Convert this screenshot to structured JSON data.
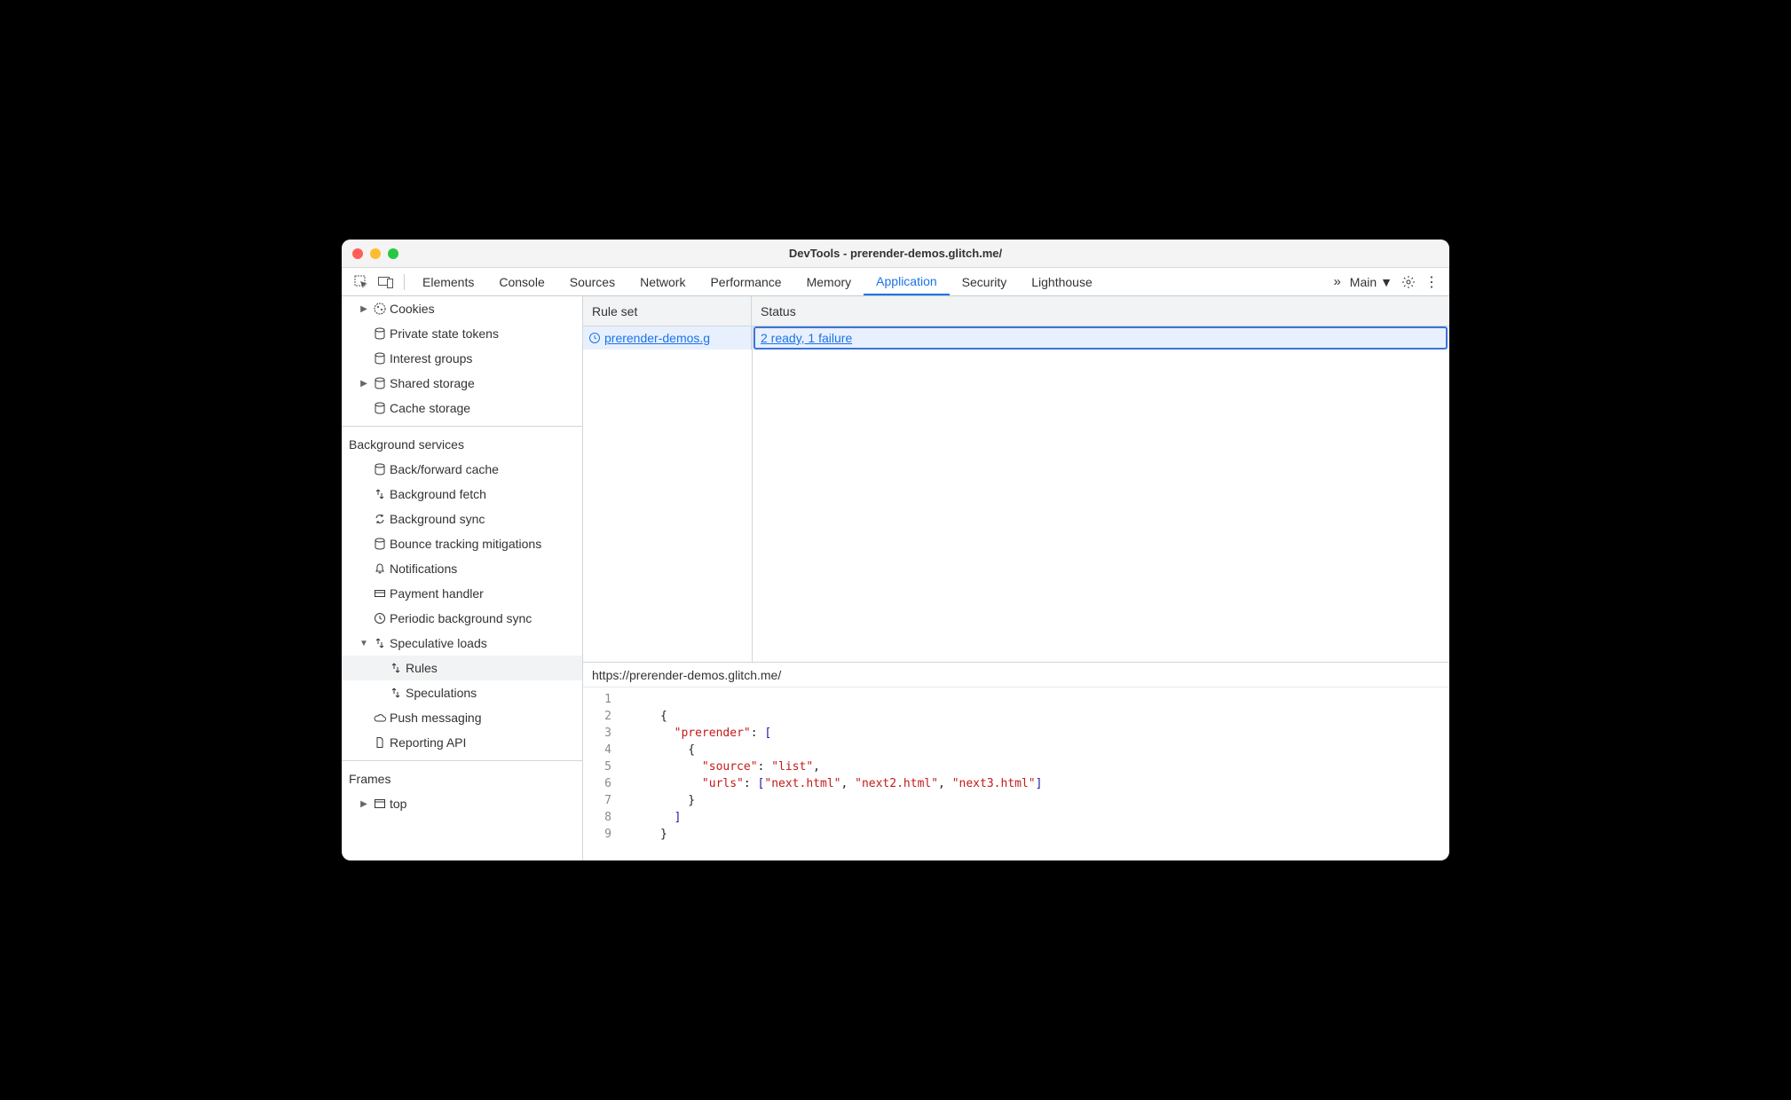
{
  "window": {
    "title": "DevTools - prerender-demos.glitch.me/"
  },
  "tabs": {
    "elements": "Elements",
    "console": "Console",
    "sources": "Sources",
    "network": "Network",
    "performance": "Performance",
    "memory": "Memory",
    "application": "Application",
    "security": "Security",
    "lighthouse": "Lighthouse"
  },
  "toolbar_right": {
    "main": "Main"
  },
  "sidebar": {
    "storage": {
      "cookies": "Cookies",
      "private_state": "Private state tokens",
      "interest_groups": "Interest groups",
      "shared_storage": "Shared storage",
      "cache_storage": "Cache storage"
    },
    "bg_services_title": "Background services",
    "bg": {
      "bfcache": "Back/forward cache",
      "bg_fetch": "Background fetch",
      "bg_sync": "Background sync",
      "bounce": "Bounce tracking mitigations",
      "notifications": "Notifications",
      "payment": "Payment handler",
      "periodic": "Periodic background sync",
      "speculative": "Speculative loads",
      "rules": "Rules",
      "speculations": "Speculations",
      "push": "Push messaging",
      "reporting": "Reporting API"
    },
    "frames_title": "Frames",
    "frames_top": "top"
  },
  "grid": {
    "col_rule": "Rule set",
    "col_status": "Status",
    "row": {
      "rule": "prerender-demos.g",
      "status": "2 ready, 1 failure"
    }
  },
  "source": {
    "url": "https://prerender-demos.glitch.me/",
    "lines": [
      "1",
      "2",
      "3",
      "4",
      "5",
      "6",
      "7",
      "8",
      "9"
    ],
    "tokens": {
      "prerender": "\"prerender\"",
      "source": "\"source\"",
      "list": "\"list\"",
      "urls": "\"urls\"",
      "u1": "\"next.html\"",
      "u2": "\"next2.html\"",
      "u3": "\"next3.html\""
    }
  }
}
